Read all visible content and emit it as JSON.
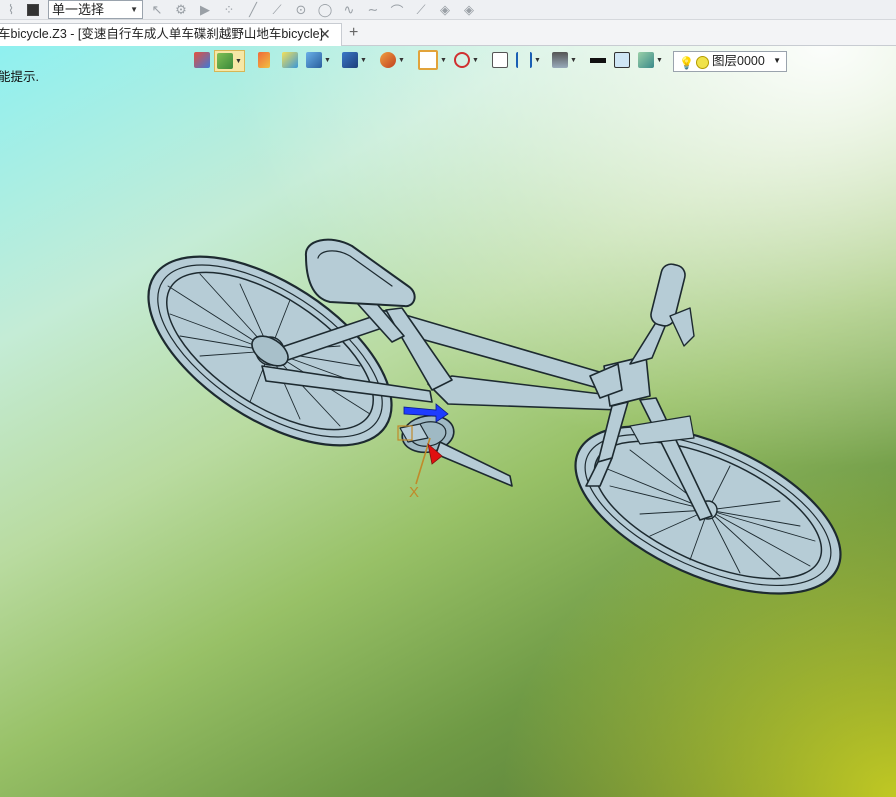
{
  "toolbar": {
    "select_mode": "单一选择",
    "icons": [
      "filter-icon",
      "stop-icon",
      "select-arrow-icon",
      "pick-icon",
      "play-icon",
      "point-icon",
      "line-icon",
      "polyline-icon",
      "circle-icon",
      "circle-icon",
      "spline-icon",
      "curve-icon",
      "arc-icon",
      "trim-icon",
      "layer-tool-icon",
      "layer-tool-icon"
    ]
  },
  "tabs": {
    "document_title": "车bicycle.Z3 - [变速自行车成人单车碟刹越野山地车bicycle]",
    "close_glyph": "✕",
    "new_tab_glyph": "+"
  },
  "viewport": {
    "hint_text": "能提示.",
    "axis_label": "X",
    "layer": {
      "name": "图层0000"
    },
    "colors": {
      "bike_body": "#b6ccd6",
      "bike_edge": "#1d2a30",
      "axis_x": "#c08a2a",
      "handle_blue": "#1e3cff",
      "handle_red": "#e01010"
    }
  }
}
